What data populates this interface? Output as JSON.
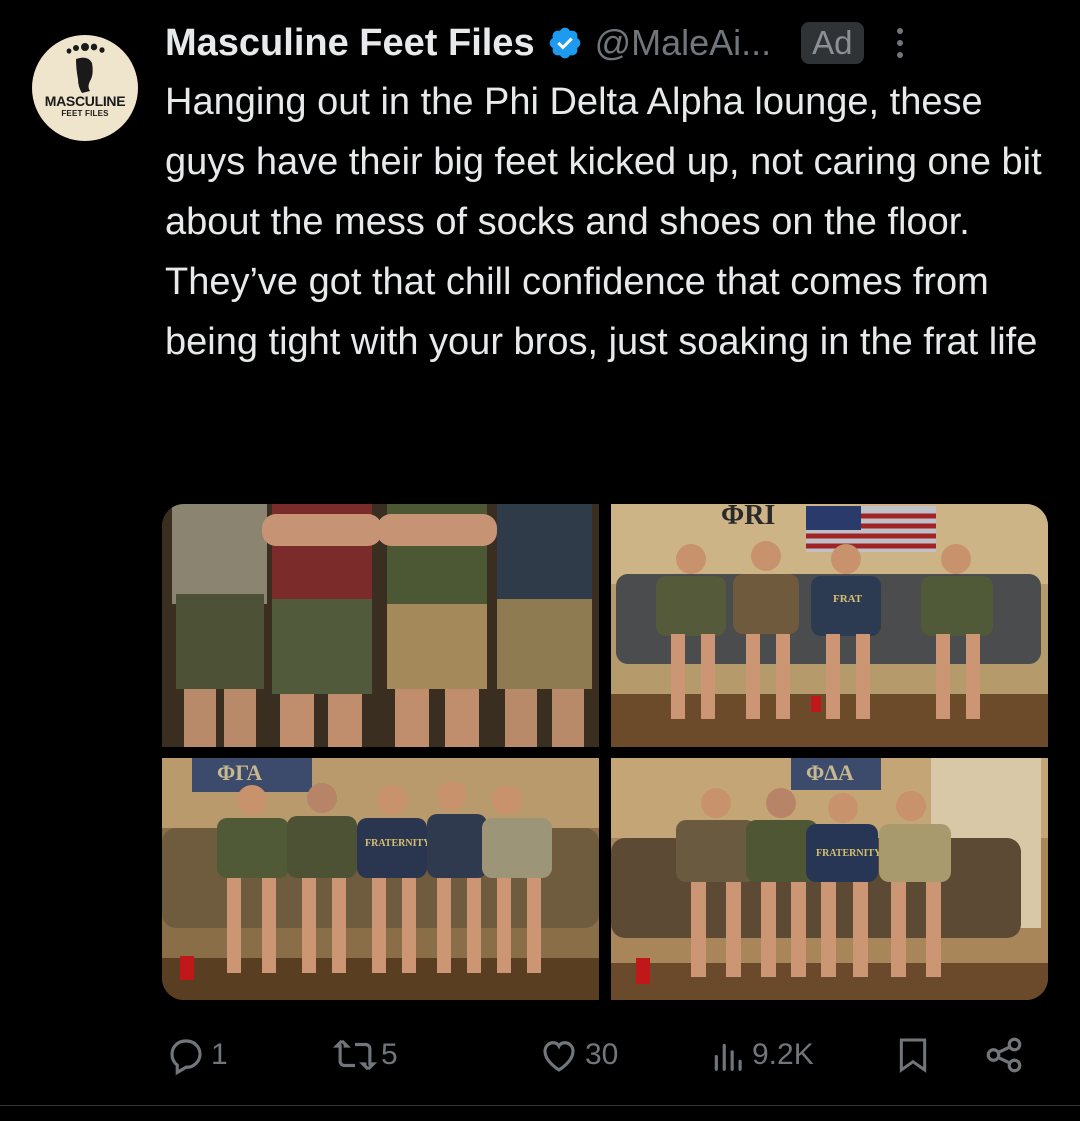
{
  "account": {
    "name": "Masculine Feet Files",
    "handle": "@MaleAi...",
    "avatar_line1": "MASCULINE",
    "avatar_line2": "FEET FILES",
    "verified_icon": "verified-badge-icon"
  },
  "badge": {
    "ad_label": "Ad"
  },
  "tweet": {
    "text": "Hanging out in the Phi Delta Alpha lounge, these guys have their big feet kicked up, not caring one bit about the mess of socks and shoes on the floor. They’ve got that chill confidence that comes from being tight with your bros, just soaking in the frat life"
  },
  "media": {
    "photo2_banner": "ΦRI",
    "photo2_shirt": "FRAT",
    "photo3_banner": "ΦΓΑ",
    "photo3_shirt": "FRATERNITY",
    "photo4_banner": "ΦΔΑ",
    "photo4_shirt": "FRATERNITY"
  },
  "actions": {
    "reply_count": "1",
    "repost_count": "5",
    "like_count": "30",
    "views_count": "9.2K"
  },
  "colors": {
    "background": "#000000",
    "text": "#e7e9ea",
    "muted": "#71767b",
    "verified": "#1d9bf0",
    "badge_bg": "#2f3336"
  }
}
